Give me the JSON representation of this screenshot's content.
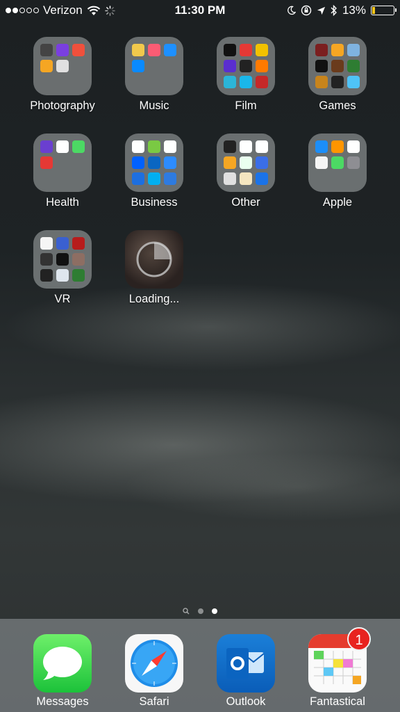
{
  "status_bar": {
    "carrier": "Verizon",
    "time": "11:30 PM",
    "battery_percent": "13%",
    "battery_level": 0.13,
    "signal_bars_filled": 2,
    "signal_bars_total": 5,
    "icons": [
      "wifi-icon",
      "activity-spinner-icon",
      "moon-icon",
      "rotation-lock-icon",
      "location-arrow-icon",
      "bluetooth-icon",
      "battery-icon"
    ]
  },
  "folders": [
    {
      "label": "Photography",
      "minis": [
        "#444",
        "#7a3fe0",
        "#f0503c",
        "#f5a623",
        "#e0e0e0",
        "",
        "",
        " ",
        ""
      ]
    },
    {
      "label": "Music",
      "minis": [
        "#f2c94c",
        "#fb5c74",
        "#1e90ff",
        "#0a8aff",
        "",
        "",
        "",
        "",
        ""
      ]
    },
    {
      "label": "Film",
      "minis": [
        "#111",
        "#e53935",
        "#f2c200",
        "#5a2ecf",
        "#222",
        "#ff7a00",
        "#2bb5d8",
        "#1ab7ea",
        "#c62828"
      ]
    },
    {
      "label": "Games",
      "minis": [
        "#7b1f1f",
        "#f5a623",
        "#7fb3e0",
        "#111",
        "#6a3b1c",
        "#2e7d32",
        "#c8841c",
        "#222",
        "#4fc3f7"
      ]
    },
    {
      "label": "Health",
      "minis": [
        "#6a3fd0",
        "#ffffff",
        "#4cd964",
        "#e53935",
        "",
        "",
        "",
        "",
        ""
      ]
    },
    {
      "label": "Business",
      "minis": [
        "#ffffff",
        "#7ac943",
        "#ffffff",
        "#0061ff",
        "#0a66c2",
        "#2d8cff",
        "#1d6fe0",
        "#00aff0",
        "#2e7be0"
      ]
    },
    {
      "label": "Other",
      "minis": [
        "#222",
        "#ffffff",
        "#ffffff",
        "#f5a623",
        "#eafff0",
        "#3a6ee8",
        "#e0e0e0",
        "#f5e6c0",
        "#1b73e8"
      ]
    },
    {
      "label": "Apple",
      "minis": [
        "#1c8ef9",
        "#ff9500",
        "#ffffff",
        "#f5f5f5",
        "#4cd964",
        "#8e8e93",
        "",
        "",
        ""
      ]
    },
    {
      "label": "VR",
      "minis": [
        "#f5f5f5",
        "#3a60d0",
        "#b71c1c",
        "#333",
        "#111",
        "#8d6e63",
        "#222",
        "#dfe6ee",
        "#2e7d32"
      ]
    }
  ],
  "loading_app": {
    "label": "Loading..."
  },
  "page_indicator": {
    "pages": 3,
    "current": 2
  },
  "dock": [
    {
      "label": "Messages"
    },
    {
      "label": "Safari"
    },
    {
      "label": "Outlook"
    },
    {
      "label": "Fantastical",
      "badge": "1"
    }
  ]
}
